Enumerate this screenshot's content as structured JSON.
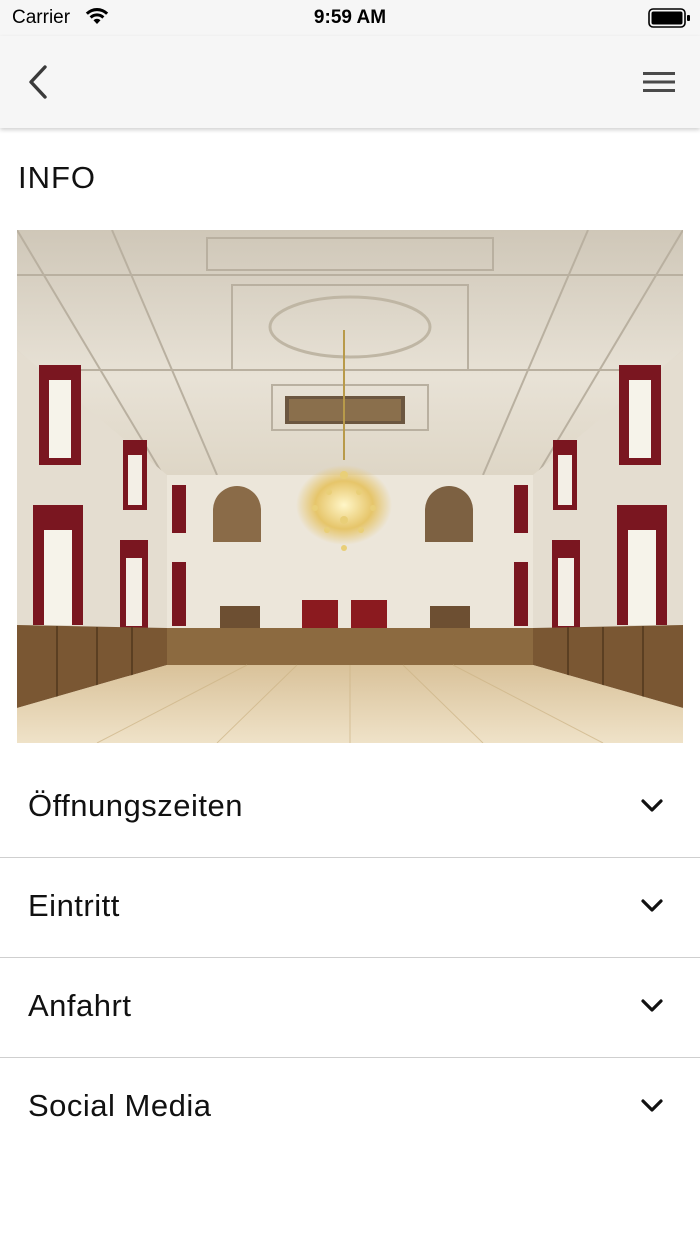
{
  "status_bar": {
    "carrier": "Carrier",
    "time": "9:59 AM"
  },
  "nav": {
    "back_icon": "chevron-left-icon",
    "menu_icon": "hamburger-menu-icon"
  },
  "page": {
    "title": "INFO"
  },
  "hero": {
    "description_icon": "ornate-ballroom-photo"
  },
  "accordion": {
    "items": [
      {
        "label": "Öffnungszeiten",
        "icon": "chevron-down-icon"
      },
      {
        "label": "Eintritt",
        "icon": "chevron-down-icon"
      },
      {
        "label": "Anfahrt",
        "icon": "chevron-down-icon"
      },
      {
        "label": "Social Media",
        "icon": "chevron-down-icon"
      }
    ]
  }
}
